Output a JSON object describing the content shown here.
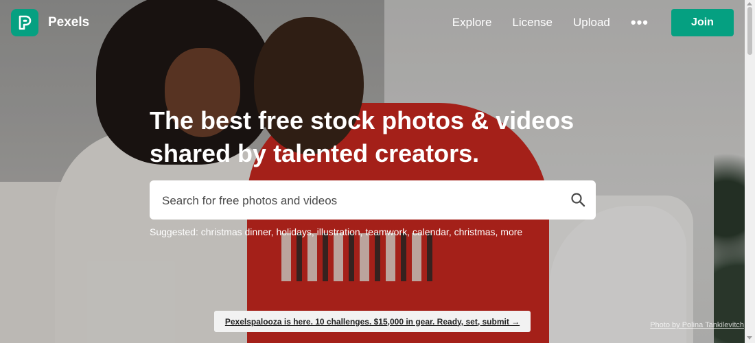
{
  "brand": {
    "name": "Pexels",
    "accent_color": "#05a081"
  },
  "nav": {
    "items": [
      {
        "label": "Explore"
      },
      {
        "label": "License"
      },
      {
        "label": "Upload"
      }
    ],
    "more_label": "•••",
    "join_label": "Join"
  },
  "hero": {
    "headline_line1": "The best free stock photos & videos",
    "headline_line2": "shared by talented creators.",
    "search_placeholder": "Search for free photos and videos",
    "suggested_label": "Suggested:",
    "suggestions": [
      "christmas dinner",
      "holidays",
      "illustration",
      "teamwork",
      "calendar",
      "christmas",
      "more"
    ]
  },
  "banner": {
    "text": "Pexelspalooza is here. 10 challenges. $15,000 in gear. Ready, set, submit →"
  },
  "credit": {
    "text": "Photo by Polina Tankilevitch"
  },
  "icons": {
    "logo": "pexels-logo-icon",
    "search": "search-icon",
    "more": "more-dots-icon"
  }
}
